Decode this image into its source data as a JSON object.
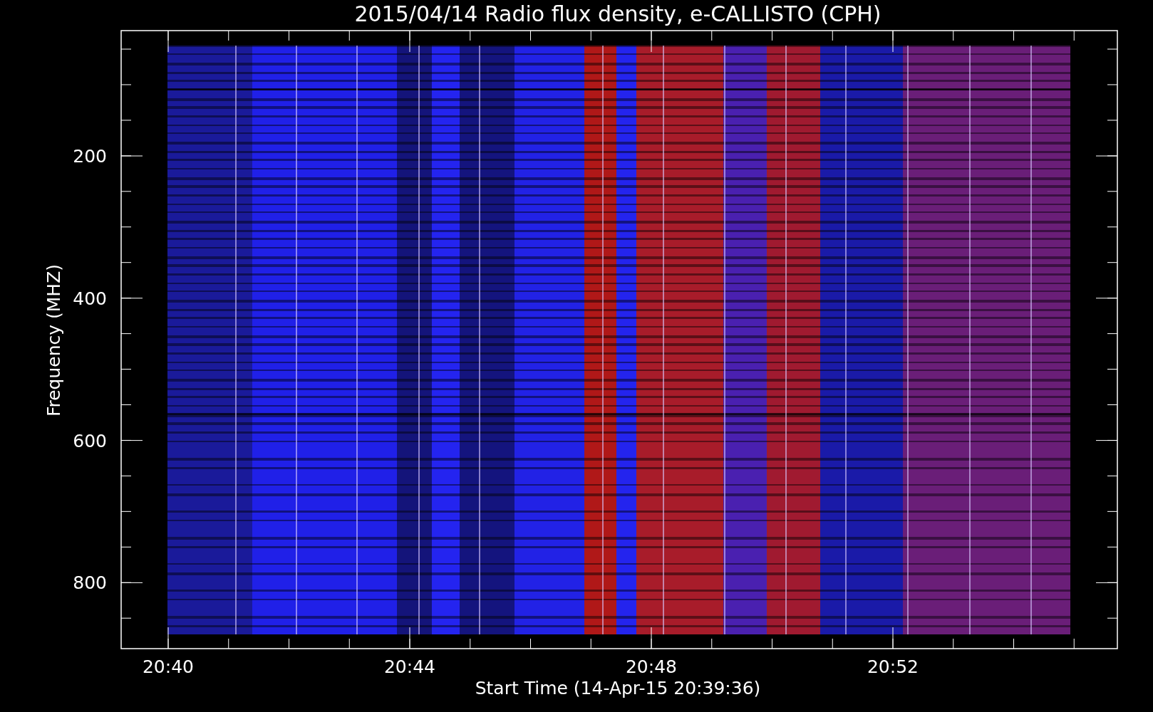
{
  "title": "2015/04/14  Radio flux density, e-CALLISTO (CPH)",
  "y_axis": {
    "label": "Frequency (MHZ)",
    "tick_labels": [
      "200",
      "400",
      "600",
      "800"
    ]
  },
  "x_axis": {
    "label": "Start Time (14-Apr-15 20:39:36)",
    "tick_labels": [
      "20:40",
      "20:44",
      "20:48",
      "20:52"
    ]
  }
}
